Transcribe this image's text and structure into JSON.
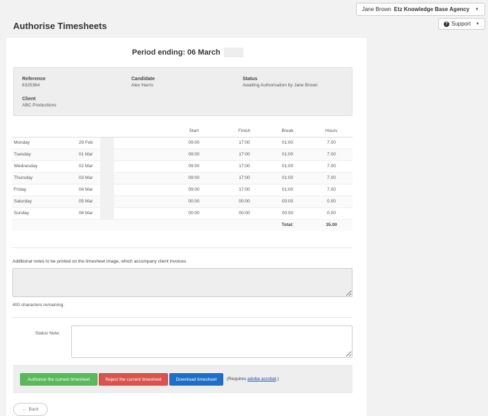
{
  "header": {
    "user_name": "Jane Brown",
    "agency_name": "Etz Knowledge Base Agency",
    "support_label": "Support",
    "page_title": "Authorise Timesheets"
  },
  "period": {
    "label": "Period ending: 06 March"
  },
  "info": {
    "reference_label": "Reference",
    "reference_value": "6325364",
    "candidate_label": "Candidate",
    "candidate_value": "Alex Harris",
    "status_label": "Status",
    "status_value": "Awaiting Authorisation by Jane Brown",
    "client_label": "Client",
    "client_value": "ABC Productions"
  },
  "table": {
    "headers": {
      "start": "Start",
      "finish": "Finish",
      "break": "Break",
      "hours": "Hours"
    },
    "rows": [
      {
        "day": "Monday",
        "date": "29 Feb",
        "start": "09:00",
        "finish": "17:00",
        "break": "01:00",
        "hours": "7.00"
      },
      {
        "day": "Tuesday",
        "date": "01 Mar",
        "start": "09:00",
        "finish": "17:00",
        "break": "01:00",
        "hours": "7.00"
      },
      {
        "day": "Wednesday",
        "date": "02 Mar",
        "start": "09:00",
        "finish": "17:00",
        "break": "01:00",
        "hours": "7.00"
      },
      {
        "day": "Thursday",
        "date": "03 Mar",
        "start": "09:00",
        "finish": "17:00",
        "break": "01:00",
        "hours": "7.00"
      },
      {
        "day": "Friday",
        "date": "04 Mar",
        "start": "09:00",
        "finish": "17:00",
        "break": "01:00",
        "hours": "7.00"
      },
      {
        "day": "Saturday",
        "date": "05 Mar",
        "start": "00:00",
        "finish": "00:00",
        "break": "00:00",
        "hours": "0.00"
      },
      {
        "day": "Sunday",
        "date": "06 Mar",
        "start": "00:00",
        "finish": "00:00",
        "break": "00:00",
        "hours": "0.00"
      }
    ],
    "total_label": "Total:",
    "total_value": "35.00"
  },
  "notes": {
    "label": "Additional notes to be printed on the timesheet image, which accompany client invoices",
    "value": "",
    "chars_remaining": "400 characters remaining."
  },
  "status_note": {
    "label": "Status Note:",
    "value": ""
  },
  "actions": {
    "authorise_label": "Authorise the current timesheet",
    "reject_label": "Reject the current timesheet",
    "download_label": "Download timesheet",
    "requires_prefix": "(Requires ",
    "acrobat_link": "adobe acrobat",
    "requires_suffix": ".)"
  },
  "back_label": "Back",
  "colors": {
    "authorise": "#5cb85c",
    "reject": "#d9534f",
    "download": "#1f6fc6"
  }
}
